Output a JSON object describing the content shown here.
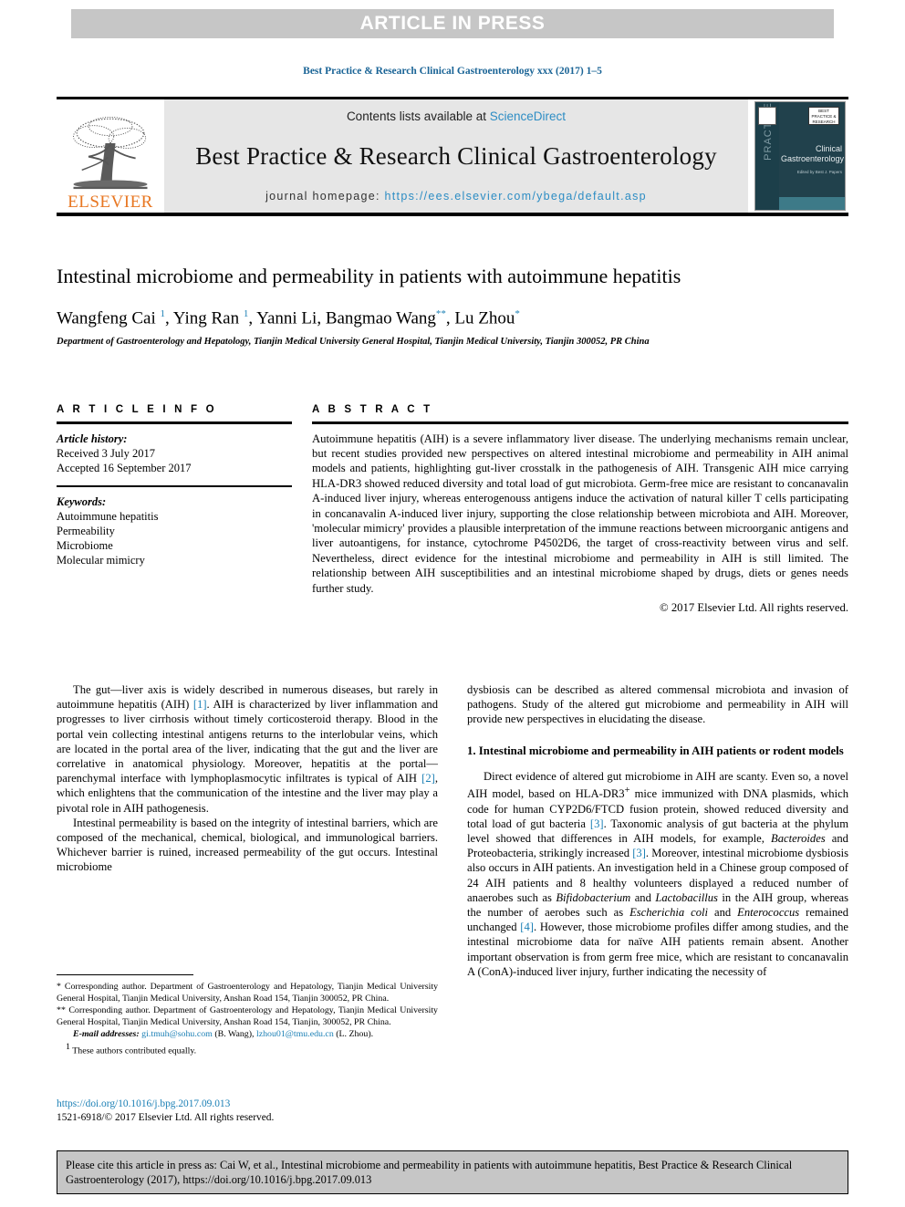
{
  "banner": {
    "text": "ARTICLE IN PRESS"
  },
  "running_head": "Best Practice & Research Clinical Gastroenterology xxx (2017) 1–5",
  "masthead": {
    "contents_prefix": "Contents lists available at ",
    "contents_link": "ScienceDirect",
    "journal_title": "Best Practice & Research Clinical Gastroenterology",
    "homepage_label": "journal homepage: ",
    "homepage_url": "https://ees.elsevier.com/ybega/default.asp",
    "publisher": "ELSEVIER",
    "cover": {
      "vertical_text": "PRACTICE",
      "title_line1": "Clinical",
      "title_line2": "Gastroenterology",
      "badge": "BEST PRACTICE & RESEARCH",
      "subtitle": "Edited by\nBest J. Papers"
    }
  },
  "article": {
    "title": "Intestinal microbiome and permeability in patients with autoimmune hepatitis",
    "authors_html": "Wangfeng Cai <sup>1</sup>, Ying Ran <sup>1</sup>, Yanni Li, Bangmao Wang<sup class=\"star\">**</sup>, Lu Zhou<sup class=\"star\">*</sup>",
    "affiliation": "Department of Gastroenterology and Hepatology, Tianjin Medical University General Hospital, Tianjin Medical University, Tianjin 300052, PR China"
  },
  "article_info": {
    "label": "A R T I C L E  I N F O",
    "history_label": "Article history:",
    "received": "Received 3 July 2017",
    "accepted": "Accepted 16 September 2017",
    "keywords_label": "Keywords:",
    "keywords": [
      "Autoimmune hepatitis",
      "Permeability",
      "Microbiome",
      "Molecular mimicry"
    ]
  },
  "abstract": {
    "label": "A B S T R A C T",
    "text": "Autoimmune hepatitis (AIH) is a severe inflammatory liver disease. The underlying mechanisms remain unclear, but recent studies provided new perspectives on altered intestinal microbiome and permeability in AIH animal models and patients, highlighting gut-liver crosstalk in the pathogenesis of AIH. Transgenic AIH mice carrying HLA-DR3 showed reduced diversity and total load of gut microbiota. Germ-free mice are resistant to concanavalin A-induced liver injury, whereas enterogenouss antigens induce the activation of natural killer T cells participating in concanavalin A-induced liver injury, supporting the close relationship between microbiota and AIH. Moreover, 'molecular mimicry' provides a plausible interpretation of the immune reactions between microorganic antigens and liver autoantigens, for instance, cytochrome P4502D6, the target of cross-reactivity between virus and self. Nevertheless, direct evidence for the intestinal microbiome and permeability in AIH is still limited. The relationship between AIH susceptibilities and an intestinal microbiome shaped by drugs, diets or genes needs further study.",
    "copyright": "© 2017 Elsevier Ltd. All rights reserved."
  },
  "body": {
    "left_para_1": "The gut—liver axis is widely described in numerous diseases, but rarely in autoimmune hepatitis (AIH) [1]. AIH is characterized by liver inflammation and progresses to liver cirrhosis without timely corticosteroid therapy. Blood in the portal vein collecting intestinal antigens returns to the interlobular veins, which are located in the portal area of the liver, indicating that the gut and the liver are correlative in anatomical physiology. Moreover, hepatitis at the portal—parenchymal interface with lymphoplasmocytic infiltrates is typical of AIH [2], which enlightens that the communication of the intestine and the liver may play a pivotal role in AIH pathogenesis.",
    "left_para_2": "Intestinal permeability is based on the integrity of intestinal barriers, which are composed of the mechanical, chemical, biological, and immunological barriers. Whichever barrier is ruined, increased permeability of the gut occurs. Intestinal microbiome",
    "right_para_1": "dysbiosis can be described as altered commensal microbiota and invasion of pathogens. Study of the altered gut microbiome and permeability in AIH will provide new perspectives in elucidating the disease.",
    "section_heading": "1. Intestinal microbiome and permeability in AIH patients or rodent models",
    "right_para_2": "Direct evidence of altered gut microbiome in AIH are scanty. Even so, a novel AIH model, based on HLA-DR3+ mice immunized with DNA plasmids, which code for human CYP2D6/FTCD fusion protein, showed reduced diversity and total load of gut bacteria [3]. Taxonomic analysis of gut bacteria at the phylum level showed that differences in AIH models, for example, Bacteroides and Proteobacteria, strikingly increased [3]. Moreover, intestinal microbiome dysbiosis also occurs in AIH patients. An investigation held in a Chinese group composed of 24 AIH patients and 8 healthy volunteers displayed a reduced number of anaerobes such as Bifidobacterium and Lactobacillus in the AIH group, whereas the number of aerobes such as Escherichia coli and Enterococcus remained unchanged [4]. However, those microbiome profiles differ among studies, and the intestinal microbiome data for naïve AIH patients remain absent. Another important observation is from germ free mice, which are resistant to concanavalin A (ConA)-induced liver injury, further indicating the necessity of"
  },
  "footnotes": {
    "corresponding_1_mark": "*",
    "corresponding_1": "Corresponding author. Department of Gastroenterology and Hepatology, Tianjin Medical University General Hospital, Tianjin Medical University, Anshan Road 154, Tianjin 300052, PR China.",
    "corresponding_2_mark": "**",
    "corresponding_2": "Corresponding author. Department of Gastroenterology and Hepatology, Tianjin Medical University General Hospital, Tianjin Medical University, Anshan Road 154, Tianjin, 300052, PR China.",
    "email_label": "E-mail addresses:",
    "email_1": "gi.tmuh@sohu.com",
    "email_1_name": "(B. Wang)",
    "email_2": "lzhou01@tmu.edu.cn",
    "email_2_name": "(L. Zhou).",
    "equal_mark": "1",
    "equal_text": "These authors contributed equally."
  },
  "doi": {
    "link": "https://doi.org/10.1016/j.bpg.2017.09.013",
    "issn": "1521-6918/© 2017 Elsevier Ltd. All rights reserved."
  },
  "citation_footer": {
    "text": "Please cite this article in press as: Cai W, et al., Intestinal microbiome and permeability in patients with autoimmune hepatitis, Best Practice & Research Clinical Gastroenterology (2017), https://doi.org/10.1016/j.bpg.2017.09.013"
  }
}
